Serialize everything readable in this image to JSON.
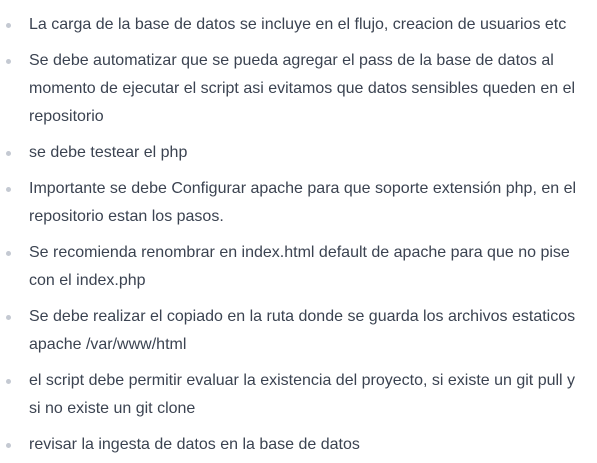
{
  "notes": {
    "items": [
      "La carga de la base de datos se incluye en el flujo, creacion de usuarios etc",
      "Se debe automatizar que se pueda agregar el pass de la base de datos al momento de ejecutar el script asi evitamos que datos sensibles queden en el repositorio",
      "se debe testear el php",
      "Importante se debe Configurar apache para que soporte extensión php, en el repositorio estan los pasos.",
      "Se recomienda renombrar en index.html default de apache para que no pise con el index.php",
      "Se debe realizar el copiado en la ruta donde se guarda los archivos estaticos apache  /var/www/html",
      "el script debe permitir evaluar la existencia del proyecto, si existe un git pull y si no existe un git clone",
      "revisar la ingesta de datos en la base de datos"
    ]
  }
}
